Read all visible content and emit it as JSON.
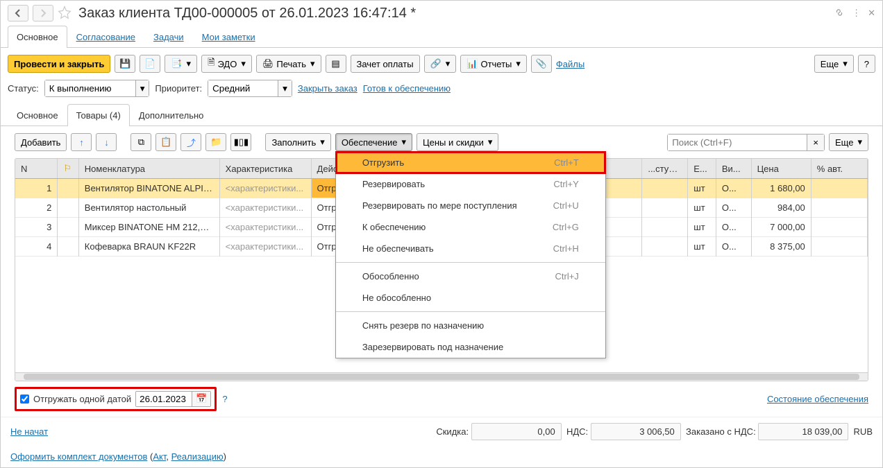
{
  "title": "Заказ клиента ТД00-000005 от 26.01.2023 16:47:14 *",
  "main_tabs": [
    "Основное",
    "Согласование",
    "Задачи",
    "Мои заметки"
  ],
  "toolbar": {
    "post_close": "Провести и закрыть",
    "edo": "ЭДО",
    "print": "Печать",
    "offset": "Зачет оплаты",
    "reports": "Отчеты",
    "files": "Файлы",
    "more": "Еще",
    "help": "?"
  },
  "status_row": {
    "status_label": "Статус:",
    "status_value": "К выполнению",
    "priority_label": "Приоритет:",
    "priority_value": "Средний",
    "close_order": "Закрыть заказ",
    "ready": "Готов к обеспечению"
  },
  "sub_tabs": [
    "Основное",
    "Товары (4)",
    "Дополнительно"
  ],
  "table_toolbar": {
    "add": "Добавить",
    "fill": "Заполнить",
    "provision": "Обеспечение",
    "prices": "Цены и скидки",
    "search_placeholder": "Поиск (Ctrl+F)",
    "more": "Еще"
  },
  "context_menu": {
    "items": [
      {
        "label": "Отгрузить",
        "shortcut": "Ctrl+T",
        "sel": true
      },
      {
        "label": "Резервировать",
        "shortcut": "Ctrl+Y"
      },
      {
        "label": "Резервировать по мере поступления",
        "shortcut": "Ctrl+U"
      },
      {
        "label": "К обеспечению",
        "shortcut": "Ctrl+G"
      },
      {
        "label": "Не обеспечивать",
        "shortcut": "Ctrl+H"
      }
    ],
    "items2": [
      {
        "label": "Обособленно",
        "shortcut": "Ctrl+J"
      },
      {
        "label": "Не обособленно",
        "shortcut": ""
      }
    ],
    "items3": [
      {
        "label": "Снять резерв по назначению",
        "shortcut": ""
      },
      {
        "label": "Зарезервировать под назначение",
        "shortcut": ""
      }
    ]
  },
  "table": {
    "headers": [
      "N",
      "",
      "Номенклатура",
      "Характеристика",
      "Действия",
      "...ступно",
      "Е...",
      "Ви...",
      "Цена",
      "% авт."
    ],
    "char_placeholder": "<характеристики...",
    "rows": [
      {
        "n": 1,
        "nom": "Вентилятор BINATONE ALPIN...",
        "act": "Отгрузить",
        "unit": "шт",
        "vid": "О...",
        "price": "1 680,00"
      },
      {
        "n": 2,
        "nom": "Вентилятор настольный",
        "act": "Отгрузить",
        "unit": "шт",
        "vid": "О...",
        "price": "984,00"
      },
      {
        "n": 3,
        "nom": "Миксер BINATONE HM 212,6 ...",
        "act": "Отгрузить",
        "unit": "шт",
        "vid": "О...",
        "price": "7 000,00"
      },
      {
        "n": 4,
        "nom": "Кофеварка BRAUN KF22R",
        "act": "Отгрузить",
        "unit": "шт",
        "vid": "О...",
        "price": "8 375,00"
      }
    ]
  },
  "footer": {
    "ship_single_label": "Отгружать одной датой",
    "ship_date": "26.01.2023",
    "state_link": "Состояние обеспечения",
    "not_started": "Не начат",
    "discount_label": "Скидка:",
    "discount_value": "0,00",
    "nds_label": "НДС:",
    "nds_value": "3 006,50",
    "total_label": "Заказано с НДС:",
    "total_value": "18 039,00",
    "currency": "RUB",
    "docs": "Оформить комплект документов",
    "docs_p1": " (",
    "docs_akt": "Акт",
    "docs_p2": ", ",
    "docs_real": "Реализацию",
    "docs_p3": ")"
  }
}
